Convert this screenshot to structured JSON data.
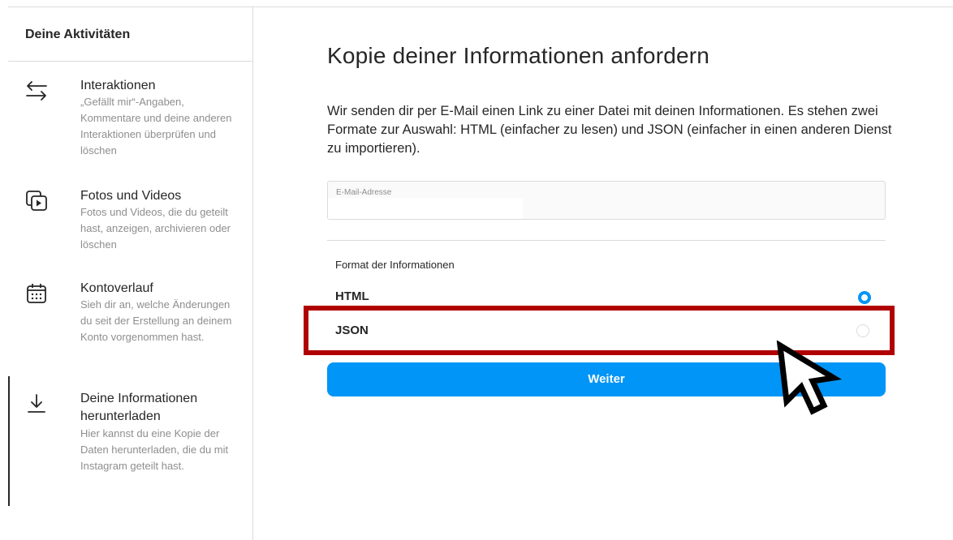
{
  "sidebar": {
    "title": "Deine Aktivitäten",
    "items": [
      {
        "title": "Interaktionen",
        "desc": "„Gefällt mir“-Angaben, Kommentare und deine anderen Interaktionen überprüfen und löschen",
        "icon": "arrows-swap-icon"
      },
      {
        "title": "Fotos und Videos",
        "desc": "Fotos und Videos, die du geteilt hast, anzeigen, archivieren oder löschen",
        "icon": "photo-video-icon"
      },
      {
        "title": "Kontoverlauf",
        "desc": "Sieh dir an, welche Änderungen du seit der Erstellung an deinem Konto vorgenommen hast.",
        "icon": "calendar-icon"
      },
      {
        "title": "Deine Informationen herunterladen",
        "desc": "Hier kannst du eine Kopie der Daten herunterladen, die du mit Instagram geteilt hast.",
        "icon": "download-icon",
        "active": true
      }
    ]
  },
  "main": {
    "title": "Kopie deiner Informationen anfordern",
    "intro": "Wir senden dir per E-Mail einen Link zu einer Datei mit deinen Informationen. Es stehen zwei Formate zur Auswahl: HTML (einfacher zu lesen) und JSON (einfacher in einen anderen Dienst zu importieren).",
    "email_label": "E-Mail-Adresse",
    "email_value": "",
    "format_label": "Format der Informationen",
    "options": [
      {
        "label": "HTML",
        "selected": true
      },
      {
        "label": "JSON",
        "selected": false
      }
    ],
    "next_button": "Weiter"
  },
  "colors": {
    "accent": "#0095f6",
    "highlight": "#b00000",
    "text": "#262626",
    "muted": "#8e8e8e",
    "border": "#dbdbdb"
  }
}
